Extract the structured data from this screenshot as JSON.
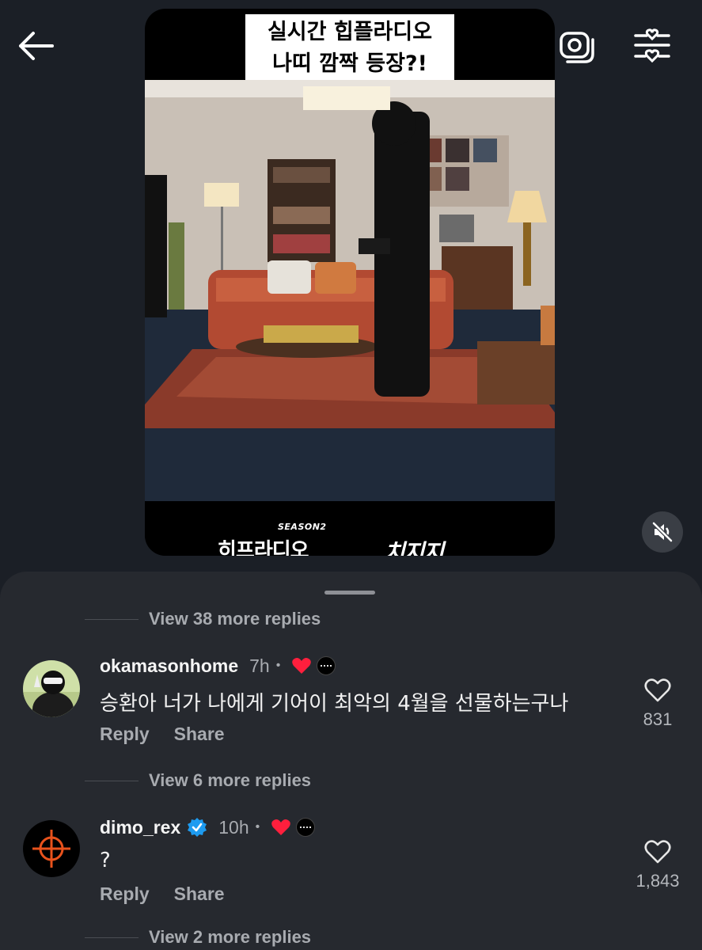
{
  "icons": {
    "back": "arrow-left-icon",
    "camera": "camera-icon",
    "filter": "heart-sliders-icon",
    "mute": "speaker-muted-icon",
    "like": "heart-outline-icon",
    "creator_like": "heart-filled-icon",
    "verified": "verified-badge-icon"
  },
  "video": {
    "caption_line1": "실시간 힙플라디오",
    "caption_line2": "나띠 깜짝 등장?!",
    "season_label": "SEASON2",
    "logo_left": "히프라디오",
    "logo_right": "치지지"
  },
  "comments": {
    "view_more_1": "View 38 more replies",
    "view_more_2": "View 6 more replies",
    "view_more_3": "View 2 more replies",
    "items": [
      {
        "username": "okamasonhome",
        "time": "7h",
        "dot": "•",
        "text": "승환아 너가 나에게 기어이 최악의 4월을 선물하는구나",
        "reply_label": "Reply",
        "share_label": "Share",
        "likes": "831"
      },
      {
        "username": "dimo_rex",
        "time": "10h",
        "dot": "•",
        "text": "?",
        "reply_label": "Reply",
        "share_label": "Share",
        "likes": "1,843",
        "verified": true
      }
    ]
  },
  "colors": {
    "background": "#1b1f26",
    "sheet": "#26292f",
    "secondary_text": "#a8abb0",
    "heart_red": "#ff1f3d",
    "verified_blue": "#1d9bf0"
  }
}
